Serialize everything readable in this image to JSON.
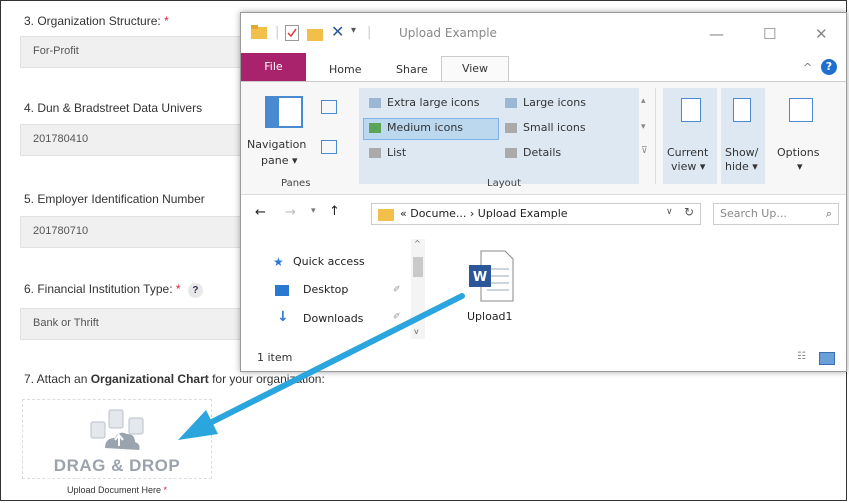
{
  "form": {
    "q3": {
      "label": "3. Organization Structure:",
      "required": "*",
      "value": "For-Profit"
    },
    "q4": {
      "label": "4. Dun & Bradstreet Data Univers",
      "value": "201780410"
    },
    "q5": {
      "label": "5. Employer Identification Number",
      "value": "201780710"
    },
    "q6": {
      "label": "6. Financial Institution Type:",
      "required": "*",
      "help": "?",
      "value": "Bank or Thrift"
    },
    "q7": {
      "pre": "7. Attach an ",
      "bold": "Organizational Chart",
      "post": " for your organization:"
    },
    "dropzone": {
      "title": "DRAG & DROP",
      "sub": "Upload Document Here",
      "required": "*"
    }
  },
  "explorer": {
    "title": "Upload Example",
    "tabs": {
      "file": "File",
      "home": "Home",
      "share": "Share",
      "view": "View"
    },
    "ribbon": {
      "nav_pane_1": "Navigation",
      "nav_pane_2": "pane ▾",
      "panes_group": "Panes",
      "extra_large": "Extra large icons",
      "large": "Large icons",
      "medium": "Medium icons",
      "small": "Small icons",
      "list": "List",
      "details": "Details",
      "layout_group": "Layout",
      "current_view_1": "Current",
      "current_view_2": "view ▾",
      "show_hide_1": "Show/",
      "show_hide_2": "hide ▾",
      "options_1": "Options",
      "options_2": "▾"
    },
    "address": {
      "path": "« Docume... › Upload Example",
      "search_placeholder": "Search Up..."
    },
    "nav": {
      "quick_access": "Quick access",
      "desktop": "Desktop",
      "downloads": "Downloads"
    },
    "file": {
      "name": "Upload1"
    },
    "status": "1 item"
  },
  "colors": {
    "file_tab": "#a8236c",
    "arrow": "#2aa5dd"
  }
}
